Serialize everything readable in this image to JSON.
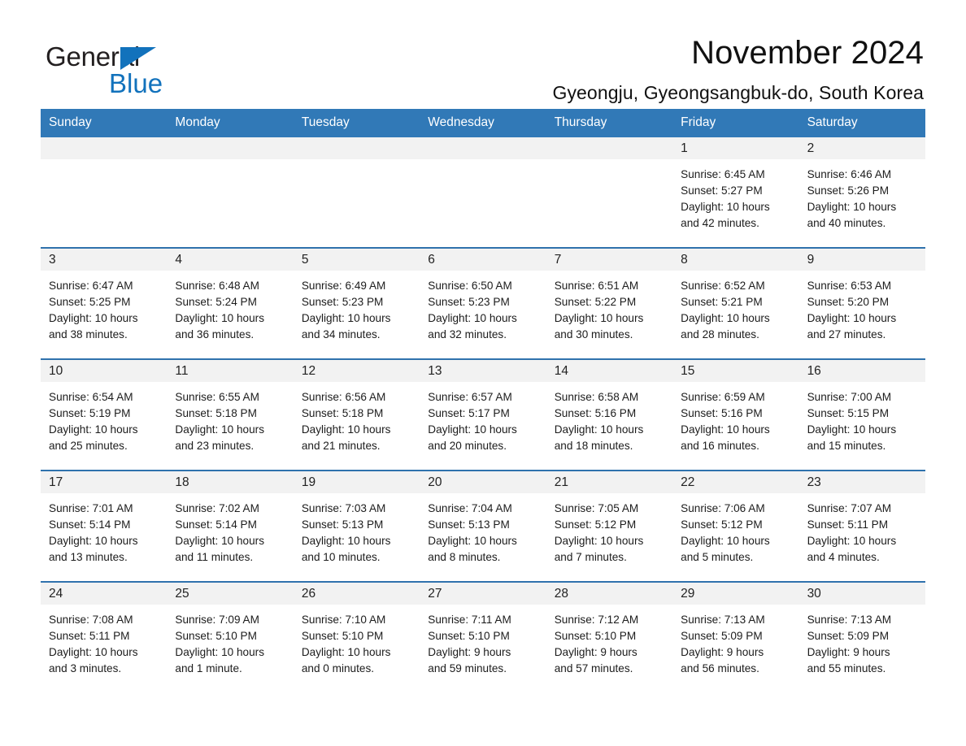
{
  "logo": {
    "word_one": "General",
    "word_two": "Blue",
    "triangle_color": "#1272bc"
  },
  "header": {
    "title": "November 2024",
    "subtitle": "Gyeongju, Gyeongsangbuk-do, South Korea"
  },
  "theme": {
    "header_blue": "#3179b7",
    "row_divider_blue": "#2f72ad",
    "daynum_band": "#f2f2f2"
  },
  "weekdays": [
    "Sunday",
    "Monday",
    "Tuesday",
    "Wednesday",
    "Thursday",
    "Friday",
    "Saturday"
  ],
  "weeks": [
    [
      {
        "day": "",
        "sunrise": "",
        "sunset": "",
        "daylight_line1": "",
        "daylight_line2": ""
      },
      {
        "day": "",
        "sunrise": "",
        "sunset": "",
        "daylight_line1": "",
        "daylight_line2": ""
      },
      {
        "day": "",
        "sunrise": "",
        "sunset": "",
        "daylight_line1": "",
        "daylight_line2": ""
      },
      {
        "day": "",
        "sunrise": "",
        "sunset": "",
        "daylight_line1": "",
        "daylight_line2": ""
      },
      {
        "day": "",
        "sunrise": "",
        "sunset": "",
        "daylight_line1": "",
        "daylight_line2": ""
      },
      {
        "day": "1",
        "sunrise": "Sunrise: 6:45 AM",
        "sunset": "Sunset: 5:27 PM",
        "daylight_line1": "Daylight: 10 hours",
        "daylight_line2": "and 42 minutes."
      },
      {
        "day": "2",
        "sunrise": "Sunrise: 6:46 AM",
        "sunset": "Sunset: 5:26 PM",
        "daylight_line1": "Daylight: 10 hours",
        "daylight_line2": "and 40 minutes."
      }
    ],
    [
      {
        "day": "3",
        "sunrise": "Sunrise: 6:47 AM",
        "sunset": "Sunset: 5:25 PM",
        "daylight_line1": "Daylight: 10 hours",
        "daylight_line2": "and 38 minutes."
      },
      {
        "day": "4",
        "sunrise": "Sunrise: 6:48 AM",
        "sunset": "Sunset: 5:24 PM",
        "daylight_line1": "Daylight: 10 hours",
        "daylight_line2": "and 36 minutes."
      },
      {
        "day": "5",
        "sunrise": "Sunrise: 6:49 AM",
        "sunset": "Sunset: 5:23 PM",
        "daylight_line1": "Daylight: 10 hours",
        "daylight_line2": "and 34 minutes."
      },
      {
        "day": "6",
        "sunrise": "Sunrise: 6:50 AM",
        "sunset": "Sunset: 5:23 PM",
        "daylight_line1": "Daylight: 10 hours",
        "daylight_line2": "and 32 minutes."
      },
      {
        "day": "7",
        "sunrise": "Sunrise: 6:51 AM",
        "sunset": "Sunset: 5:22 PM",
        "daylight_line1": "Daylight: 10 hours",
        "daylight_line2": "and 30 minutes."
      },
      {
        "day": "8",
        "sunrise": "Sunrise: 6:52 AM",
        "sunset": "Sunset: 5:21 PM",
        "daylight_line1": "Daylight: 10 hours",
        "daylight_line2": "and 28 minutes."
      },
      {
        "day": "9",
        "sunrise": "Sunrise: 6:53 AM",
        "sunset": "Sunset: 5:20 PM",
        "daylight_line1": "Daylight: 10 hours",
        "daylight_line2": "and 27 minutes."
      }
    ],
    [
      {
        "day": "10",
        "sunrise": "Sunrise: 6:54 AM",
        "sunset": "Sunset: 5:19 PM",
        "daylight_line1": "Daylight: 10 hours",
        "daylight_line2": "and 25 minutes."
      },
      {
        "day": "11",
        "sunrise": "Sunrise: 6:55 AM",
        "sunset": "Sunset: 5:18 PM",
        "daylight_line1": "Daylight: 10 hours",
        "daylight_line2": "and 23 minutes."
      },
      {
        "day": "12",
        "sunrise": "Sunrise: 6:56 AM",
        "sunset": "Sunset: 5:18 PM",
        "daylight_line1": "Daylight: 10 hours",
        "daylight_line2": "and 21 minutes."
      },
      {
        "day": "13",
        "sunrise": "Sunrise: 6:57 AM",
        "sunset": "Sunset: 5:17 PM",
        "daylight_line1": "Daylight: 10 hours",
        "daylight_line2": "and 20 minutes."
      },
      {
        "day": "14",
        "sunrise": "Sunrise: 6:58 AM",
        "sunset": "Sunset: 5:16 PM",
        "daylight_line1": "Daylight: 10 hours",
        "daylight_line2": "and 18 minutes."
      },
      {
        "day": "15",
        "sunrise": "Sunrise: 6:59 AM",
        "sunset": "Sunset: 5:16 PM",
        "daylight_line1": "Daylight: 10 hours",
        "daylight_line2": "and 16 minutes."
      },
      {
        "day": "16",
        "sunrise": "Sunrise: 7:00 AM",
        "sunset": "Sunset: 5:15 PM",
        "daylight_line1": "Daylight: 10 hours",
        "daylight_line2": "and 15 minutes."
      }
    ],
    [
      {
        "day": "17",
        "sunrise": "Sunrise: 7:01 AM",
        "sunset": "Sunset: 5:14 PM",
        "daylight_line1": "Daylight: 10 hours",
        "daylight_line2": "and 13 minutes."
      },
      {
        "day": "18",
        "sunrise": "Sunrise: 7:02 AM",
        "sunset": "Sunset: 5:14 PM",
        "daylight_line1": "Daylight: 10 hours",
        "daylight_line2": "and 11 minutes."
      },
      {
        "day": "19",
        "sunrise": "Sunrise: 7:03 AM",
        "sunset": "Sunset: 5:13 PM",
        "daylight_line1": "Daylight: 10 hours",
        "daylight_line2": "and 10 minutes."
      },
      {
        "day": "20",
        "sunrise": "Sunrise: 7:04 AM",
        "sunset": "Sunset: 5:13 PM",
        "daylight_line1": "Daylight: 10 hours",
        "daylight_line2": "and 8 minutes."
      },
      {
        "day": "21",
        "sunrise": "Sunrise: 7:05 AM",
        "sunset": "Sunset: 5:12 PM",
        "daylight_line1": "Daylight: 10 hours",
        "daylight_line2": "and 7 minutes."
      },
      {
        "day": "22",
        "sunrise": "Sunrise: 7:06 AM",
        "sunset": "Sunset: 5:12 PM",
        "daylight_line1": "Daylight: 10 hours",
        "daylight_line2": "and 5 minutes."
      },
      {
        "day": "23",
        "sunrise": "Sunrise: 7:07 AM",
        "sunset": "Sunset: 5:11 PM",
        "daylight_line1": "Daylight: 10 hours",
        "daylight_line2": "and 4 minutes."
      }
    ],
    [
      {
        "day": "24",
        "sunrise": "Sunrise: 7:08 AM",
        "sunset": "Sunset: 5:11 PM",
        "daylight_line1": "Daylight: 10 hours",
        "daylight_line2": "and 3 minutes."
      },
      {
        "day": "25",
        "sunrise": "Sunrise: 7:09 AM",
        "sunset": "Sunset: 5:10 PM",
        "daylight_line1": "Daylight: 10 hours",
        "daylight_line2": "and 1 minute."
      },
      {
        "day": "26",
        "sunrise": "Sunrise: 7:10 AM",
        "sunset": "Sunset: 5:10 PM",
        "daylight_line1": "Daylight: 10 hours",
        "daylight_line2": "and 0 minutes."
      },
      {
        "day": "27",
        "sunrise": "Sunrise: 7:11 AM",
        "sunset": "Sunset: 5:10 PM",
        "daylight_line1": "Daylight: 9 hours",
        "daylight_line2": "and 59 minutes."
      },
      {
        "day": "28",
        "sunrise": "Sunrise: 7:12 AM",
        "sunset": "Sunset: 5:10 PM",
        "daylight_line1": "Daylight: 9 hours",
        "daylight_line2": "and 57 minutes."
      },
      {
        "day": "29",
        "sunrise": "Sunrise: 7:13 AM",
        "sunset": "Sunset: 5:09 PM",
        "daylight_line1": "Daylight: 9 hours",
        "daylight_line2": "and 56 minutes."
      },
      {
        "day": "30",
        "sunrise": "Sunrise: 7:13 AM",
        "sunset": "Sunset: 5:09 PM",
        "daylight_line1": "Daylight: 9 hours",
        "daylight_line2": "and 55 minutes."
      }
    ]
  ]
}
